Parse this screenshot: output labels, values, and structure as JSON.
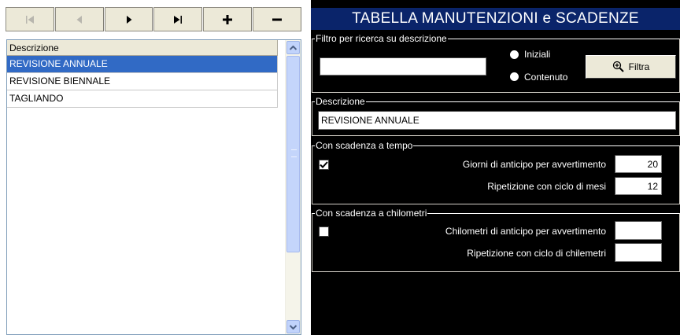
{
  "navigator": {
    "buttons": [
      {
        "name": "first-record-icon",
        "enabled": false
      },
      {
        "name": "previous-record-icon",
        "enabled": false
      },
      {
        "name": "next-record-icon",
        "enabled": true
      },
      {
        "name": "last-record-icon",
        "enabled": true
      },
      {
        "name": "add-record-icon",
        "enabled": true
      },
      {
        "name": "delete-record-icon",
        "enabled": true
      }
    ]
  },
  "grid": {
    "header": "Descrizione",
    "rows": [
      "REVISIONE ANNUALE",
      "REVISIONE BIENNALE",
      "TAGLIANDO"
    ],
    "selected_index": 0
  },
  "title": "TABELLA MANUTENZIONI e SCADENZE",
  "filter": {
    "legend": "Filtro per ricerca su descrizione",
    "value": "",
    "option_initial": "Iniziali",
    "option_content": "Contenuto",
    "button": "Filtra"
  },
  "description": {
    "legend": "Descrizione",
    "value": "REVISIONE ANNUALE"
  },
  "time_expiry": {
    "legend": "Con scadenza a tempo",
    "checked": true,
    "advance_label": "Giorni di anticipo per avvertimento",
    "advance_value": "20",
    "cycle_label": "Ripetizione con ciclo di mesi",
    "cycle_value": "12"
  },
  "km_expiry": {
    "legend": "Con scadenza a chilometri",
    "checked": false,
    "advance_label": "Chilometri di anticipo per avvertimento",
    "advance_value": "",
    "cycle_label": "Ripetizione con ciclo di chilemetri",
    "cycle_value": ""
  }
}
